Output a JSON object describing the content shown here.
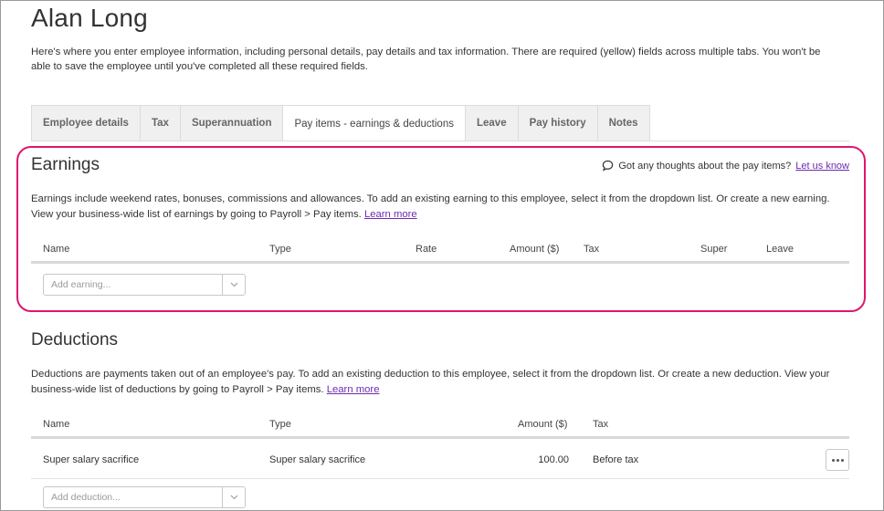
{
  "page": {
    "title": "Alan Long",
    "intro": "Here's where you enter employee information, including personal details, pay details and tax information. There are required (yellow) fields across multiple tabs. You won't be able to save the employee until you've completed all these required fields."
  },
  "tabs": [
    {
      "label": "Employee details",
      "active": false
    },
    {
      "label": "Tax",
      "active": false
    },
    {
      "label": "Superannuation",
      "active": false
    },
    {
      "label": "Pay items - earnings & deductions",
      "active": true
    },
    {
      "label": "Leave",
      "active": false
    },
    {
      "label": "Pay history",
      "active": false
    },
    {
      "label": "Notes",
      "active": false
    }
  ],
  "earnings": {
    "title": "Earnings",
    "feedback_text": "Got any thoughts about the pay items?",
    "feedback_link": "Let us know",
    "description": "Earnings include weekend rates, bonuses, commissions and allowances. To add an existing earning to this employee, select it from the dropdown list. Or create a new earning. View your business-wide list of earnings by going to Payroll > Pay items.",
    "learn_more": "Learn more",
    "columns": {
      "name": "Name",
      "type": "Type",
      "rate": "Rate",
      "amount": "Amount ($)",
      "tax": "Tax",
      "super": "Super",
      "leave": "Leave"
    },
    "add_placeholder": "Add earning..."
  },
  "deductions": {
    "title": "Deductions",
    "description": "Deductions are payments taken out of an employee's pay. To add an existing deduction to this employee, select it from the dropdown list. Or create a new deduction. View your business-wide list of deductions by going to Payroll > Pay items.",
    "learn_more": "Learn more",
    "columns": {
      "name": "Name",
      "type": "Type",
      "amount": "Amount ($)",
      "tax": "Tax"
    },
    "rows": [
      {
        "name": "Super salary sacrifice",
        "type": "Super salary sacrifice",
        "amount": "100.00",
        "tax": "Before tax"
      }
    ],
    "add_placeholder": "Add deduction..."
  },
  "colors": {
    "highlight": "#e0156e",
    "link": "#6b2bb2"
  },
  "icons": {
    "feedback": "speech-bubble-icon",
    "dropdown": "chevron-down-icon",
    "more": "more-horizontal-icon"
  }
}
